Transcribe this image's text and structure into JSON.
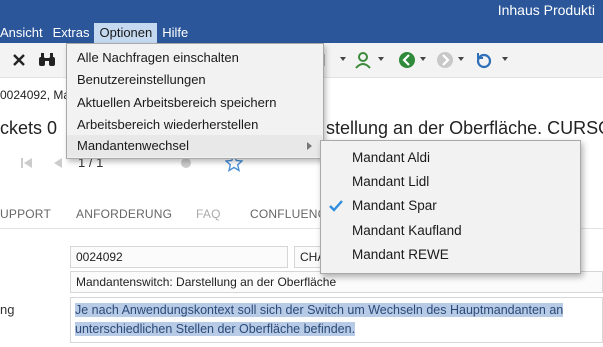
{
  "window": {
    "title": "Inhaus Produkti"
  },
  "menubar": {
    "items": [
      {
        "label": "Ansicht"
      },
      {
        "label": "Extras"
      },
      {
        "label": "Optionen"
      },
      {
        "label": "Hilfe"
      }
    ]
  },
  "optionen_menu": {
    "items": [
      {
        "label": "Alle Nachfragen einschalten"
      },
      {
        "label": "Benutzereinstellungen"
      },
      {
        "label": "Aktuellen Arbeitsbereich speichern"
      },
      {
        "label": "Arbeitsbereich wiederherstellen"
      },
      {
        "label": "Mandantenwechsel"
      }
    ]
  },
  "mandant_menu": {
    "items": [
      {
        "label": "Mandant Aldi",
        "checked": false
      },
      {
        "label": "Mandant Lidl",
        "checked": false
      },
      {
        "label": "Mandant Spar",
        "checked": true
      },
      {
        "label": "Mandant Kaufland",
        "checked": false
      },
      {
        "label": "Mandant REWE",
        "checked": false
      }
    ]
  },
  "record": {
    "line": "0024092, Ma",
    "title_left": "ckets  0",
    "title_right": "stellung an der Oberfläche. CURSOR",
    "counter": "1 / 1"
  },
  "tabs": [
    {
      "label": "UPPORT"
    },
    {
      "label": "ANFORDERUNG"
    },
    {
      "label": "FAQ"
    },
    {
      "label": "CONFLUENC"
    }
  ],
  "fields": {
    "ticket_id": "0024092",
    "channel": "CHA",
    "subject": "Mandantenswitch: Darstellung an der Oberfläche",
    "description_label": "ng",
    "description": "Je nach Anwendungskontext soll sich der Switch um Wechseln des Hauptmandanten an unterschiedlichen Stellen der Oberfläche befinden."
  },
  "colors": {
    "titlebar": "#2b579a",
    "menu_active": "#c5d9f1",
    "check": "#2f8ee0",
    "selection": "#b8cbe6"
  }
}
